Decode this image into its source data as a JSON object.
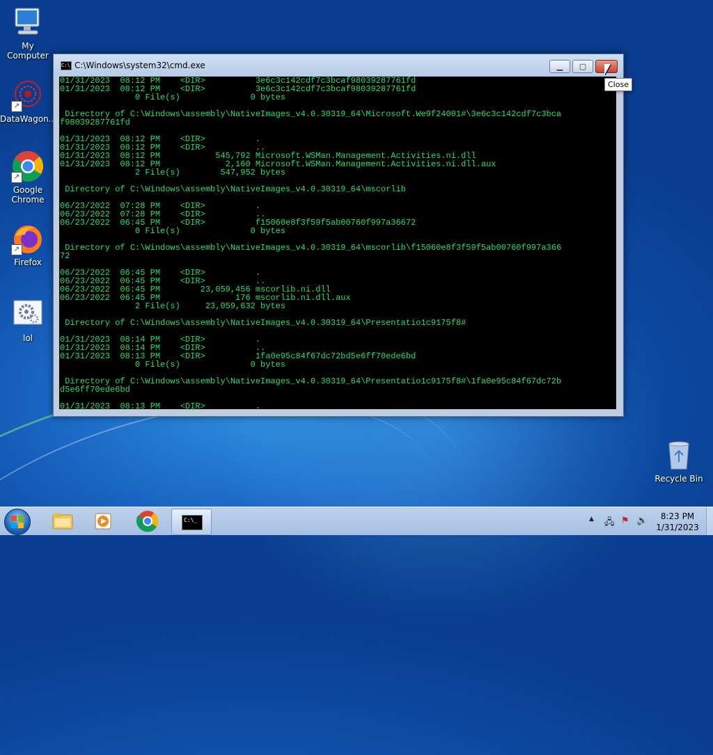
{
  "desktop": {
    "icons": [
      {
        "label": "My Computer"
      },
      {
        "label": "DataWagon..."
      },
      {
        "label": "Google Chrome"
      },
      {
        "label": "Firefox"
      },
      {
        "label": "lol"
      },
      {
        "label": "Recycle Bin"
      }
    ]
  },
  "cmd": {
    "title": "C:\\Windows\\system32\\cmd.exe",
    "icon_text": "C:\\",
    "buttons": {
      "minimize": "▁",
      "maximize": "▢",
      "close": "✕"
    },
    "lines": [
      "01/31/2023  08:12 PM    <DIR>          3e6c3c142cdf7c3bcaf98039287761fd",
      "01/31/2023  08:12 PM    <DIR>          3e6c3c142cdf7c3bcaf98039287761fd",
      "               0 File(s)              0 bytes",
      "",
      " Directory of C:\\Windows\\assembly\\NativeImages_v4.0.30319_64\\Microsoft.We9f24001#\\3e6c3c142cdf7c3bca",
      "f98039287761fd",
      "",
      "01/31/2023  08:12 PM    <DIR>          .",
      "01/31/2023  08:12 PM    <DIR>          ..",
      "01/31/2023  08:12 PM           545,792 Microsoft.WSMan.Management.Activities.ni.dll",
      "01/31/2023  08:12 PM             2,160 Microsoft.WSMan.Management.Activities.ni.dll.aux",
      "               2 File(s)        547,952 bytes",
      "",
      " Directory of C:\\Windows\\assembly\\NativeImages_v4.0.30319_64\\mscorlib",
      "",
      "06/23/2022  07:28 PM    <DIR>          .",
      "06/23/2022  07:28 PM    <DIR>          ..",
      "06/23/2022  06:45 PM    <DIR>          f15060e8f3f59f5ab00760f997a36672",
      "               0 File(s)              0 bytes",
      "",
      " Directory of C:\\Windows\\assembly\\NativeImages_v4.0.30319_64\\mscorlib\\f15060e8f3f59f5ab00760f997a366",
      "72",
      "",
      "06/23/2022  06:45 PM    <DIR>          .",
      "06/23/2022  06:45 PM    <DIR>          ..",
      "06/23/2022  06:45 PM        23,059,456 mscorlib.ni.dll",
      "06/23/2022  06:45 PM               176 mscorlib.ni.dll.aux",
      "               2 File(s)     23,059,632 bytes",
      "",
      " Directory of C:\\Windows\\assembly\\NativeImages_v4.0.30319_64\\Presentatio1c9175f8#",
      "",
      "01/31/2023  08:14 PM    <DIR>          .",
      "01/31/2023  08:14 PM    <DIR>          ..",
      "01/31/2023  08:13 PM    <DIR>          1fa0e95c84f67dc72bd5e6ff70ede6bd",
      "               0 File(s)              0 bytes",
      "",
      " Directory of C:\\Windows\\assembly\\NativeImages_v4.0.30319_64\\Presentatio1c9175f8#\\1fa0e95c84f67dc72b",
      "d5e6ff70ede6bd",
      "",
      "01/31/2023  08:13 PM    <DIR>          ."
    ]
  },
  "tooltip": {
    "text": "Close"
  },
  "taskbar": {
    "cmd_icon_text": "C:\\_",
    "clock": {
      "time": "8:23 PM",
      "date": "1/31/2023"
    },
    "tray": {
      "expand": "▲",
      "network": "🖧",
      "flag": "⚑",
      "volume": "🔊"
    }
  },
  "colors": {
    "console_text": "#16e26a",
    "console_bg": "#000000"
  }
}
